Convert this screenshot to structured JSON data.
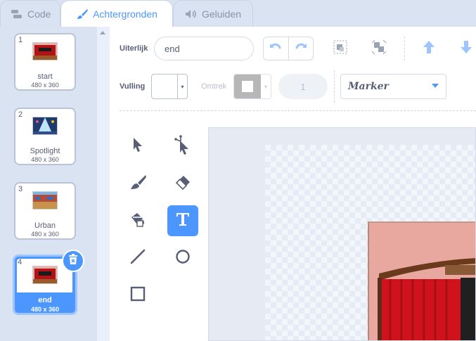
{
  "tabs": [
    {
      "label": "Code",
      "icon": "code-blocks-icon"
    },
    {
      "label": "Achtergronden",
      "icon": "paintbrush-icon",
      "active": true
    },
    {
      "label": "Geluiden",
      "icon": "speaker-icon"
    }
  ],
  "backdrops": [
    {
      "number": "1",
      "name": "start",
      "size": "480 x 360"
    },
    {
      "number": "2",
      "name": "Spotlight",
      "size": "480 x 360"
    },
    {
      "number": "3",
      "name": "Urban",
      "size": "480 x 360"
    },
    {
      "number": "4",
      "name": "end",
      "size": "480 x 360",
      "selected": true
    }
  ],
  "editor": {
    "costume_label": "Uiterlijk",
    "costume_name": "end",
    "fill_label": "Vulling",
    "outline_label": "Omtrek",
    "outline_width": "1",
    "font": "Marker"
  },
  "colors": {
    "accent": "#4c97ff",
    "panel_bg": "#d9e3f2",
    "text": "#575e75",
    "curtain_red": "#d0121c",
    "wall_pink": "#e8a8a0"
  }
}
